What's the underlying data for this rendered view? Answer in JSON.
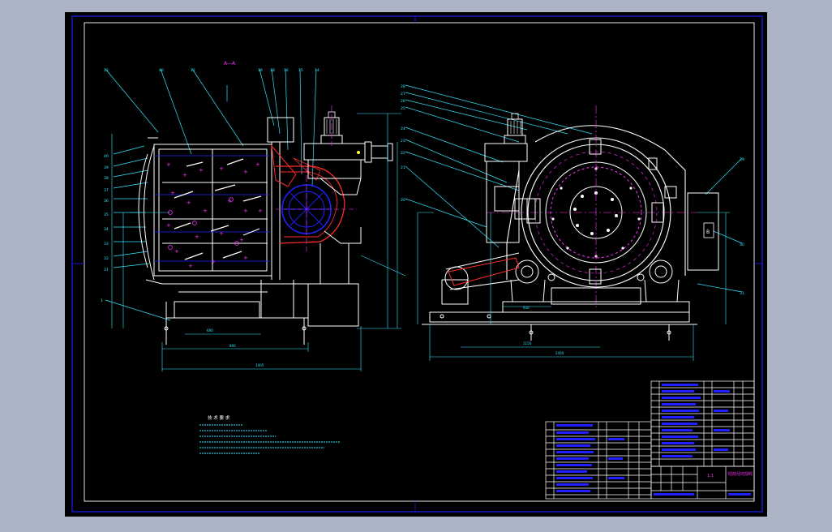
{
  "window": {
    "background": "#aab4c4",
    "sheet_color": "#000000",
    "line_color": "#ffffff",
    "frame_color": "#2020ff",
    "cyan": "#33e6ff",
    "magenta": "#ff33ff",
    "red": "#ff2a2a",
    "yellow": "#ffff33"
  },
  "drawing": {
    "section_label": "A—A",
    "tech_req_title": "技 术 要 求",
    "title_block_name": "新型高效大型冲击式破碎机",
    "title_block_small": "1:1",
    "left_leaders": [
      "13",
      "40",
      "12",
      "19",
      "18",
      "16",
      "15",
      "14",
      "13"
    ],
    "right_leaders": [
      "28",
      "27",
      "26",
      "25",
      "24",
      "23",
      "22",
      "21"
    ],
    "icons": {
      "motor": "motor-icon",
      "rotor": "rotor-icon",
      "cabinet": "control-box-icon"
    }
  }
}
